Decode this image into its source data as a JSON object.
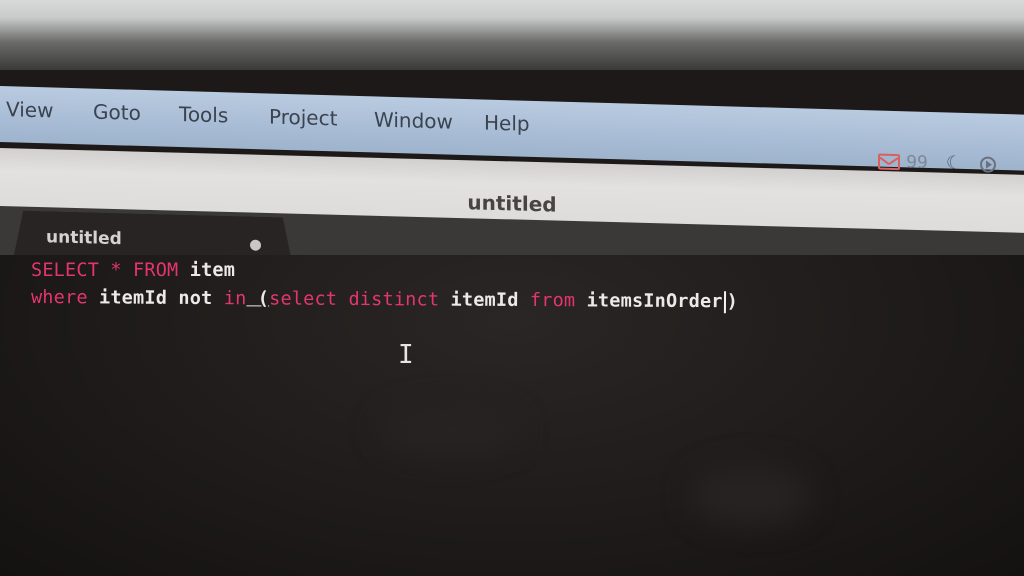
{
  "menubar": {
    "items": [
      "View",
      "Goto",
      "Tools",
      "Project",
      "Window",
      "Help"
    ],
    "status": {
      "mail_count": "99",
      "icons": [
        "mail-icon",
        "moon-icon",
        "play-circle-icon"
      ]
    }
  },
  "window": {
    "title": "untitled"
  },
  "tabs": [
    {
      "label": "untitled",
      "modified": true
    }
  ],
  "editor": {
    "line1": {
      "select": "SELECT",
      "star": " * ",
      "from": "FROM",
      "table": " item"
    },
    "line2": {
      "where": "where",
      "col": " itemId",
      "not": " not",
      "in": " in",
      "paren": " (",
      "select": "select",
      "distinct": " distinct",
      "col2": " itemId",
      "from": " from",
      "table2": " itemsInOrder",
      "close": ")"
    }
  },
  "colors": {
    "keyword": "#e4356e",
    "identifier": "#ece9e7",
    "menubar": "#a8bcd5",
    "titlebar": "#dcdad9",
    "editor_bg": "#1e1b1a"
  }
}
